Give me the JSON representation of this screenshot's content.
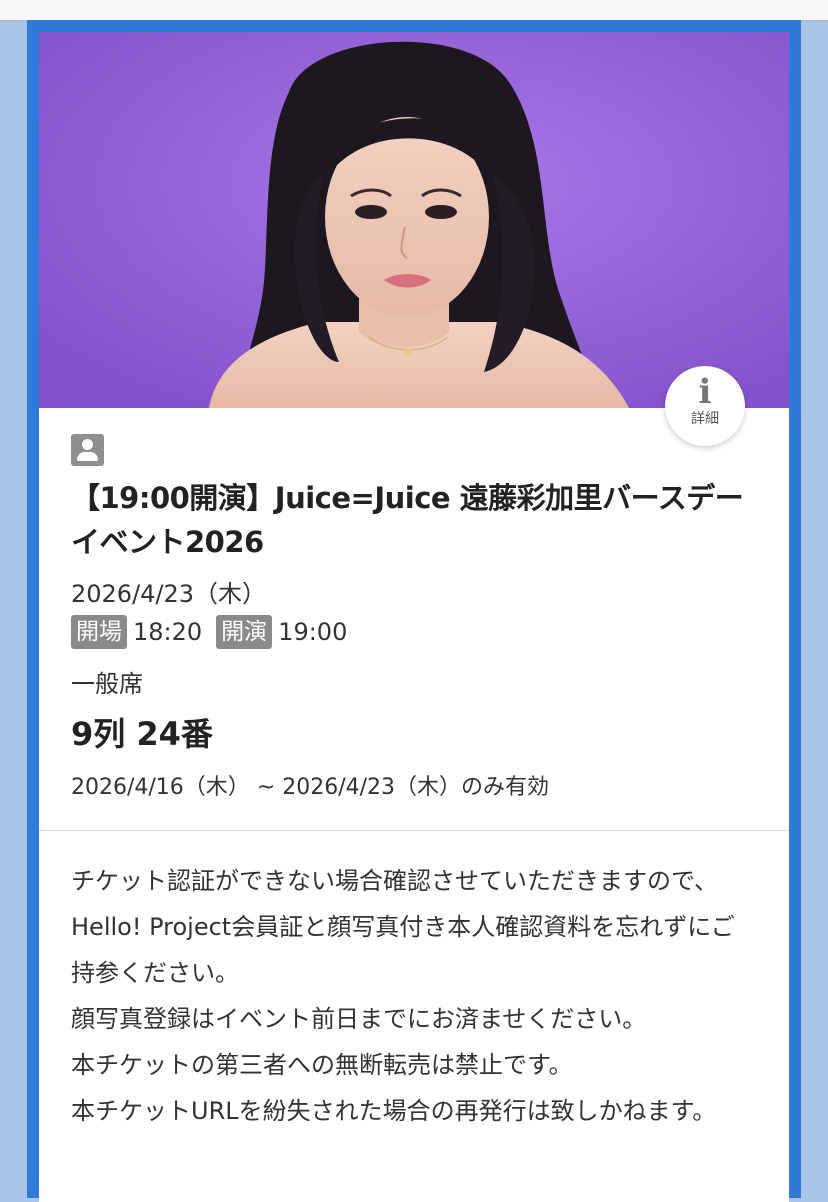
{
  "header": {
    "image_alt": ""
  },
  "info_button": {
    "icon": "i",
    "label": "詳細"
  },
  "ticket": {
    "user_icon": "person-icon",
    "title": "【19:00開演】Juice=Juice 遠藤彩加里バースデーイベント2026",
    "date": "2026/4/23（木）",
    "open_label": "開場",
    "open_time": "18:20",
    "start_label": "開演",
    "start_time": "19:00",
    "seat_type": "一般席",
    "seat_number": "9列 24番",
    "validity": "2026/4/16（木） ~ 2026/4/23（木）のみ有効"
  },
  "notice": {
    "lines": [
      "チケット認証ができない場合確認させていただきますので、Hello! Project会員証と顔写真付き本人確認資料を忘れずにご持参ください。",
      "顔写真登録はイベント前日までにお済ませください。",
      "本チケットの第三者への無断転売は禁止です。",
      "本チケットURLを紛失された場合の再発行は致しかねます。"
    ]
  },
  "colors": {
    "frame_blue": "#2f7ad9",
    "page_bg": "#a9c6e8",
    "hero_purple": "#9263d9",
    "tag_gray": "#8a8a8a"
  }
}
